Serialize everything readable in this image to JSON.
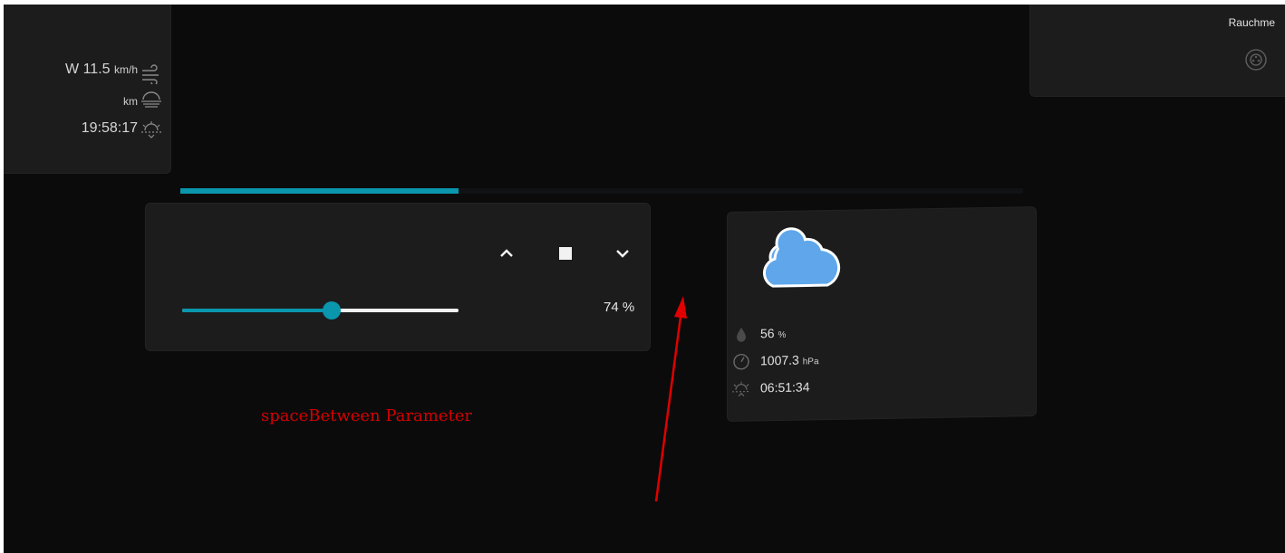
{
  "weather_top": {
    "wind_value": "W 11.5",
    "wind_unit": "km/h",
    "visibility_unit": "km",
    "sunset_time": "19:58:17",
    "icons": [
      "wind-icon",
      "fog-icon",
      "sunset-icon"
    ]
  },
  "smoke_detector": {
    "label": "Rauchme",
    "icon": "smoke-detector-icon"
  },
  "shutter": {
    "progress": 0.33,
    "position_percent": 74,
    "percent_text": "74 %",
    "buttons": [
      "chevron-up-icon",
      "stop-icon",
      "chevron-down-icon"
    ]
  },
  "weather_card": {
    "condition_icon": "cloud-icon",
    "humidity_value": "56",
    "humidity_unit": "%",
    "pressure_value": "1007.3",
    "pressure_unit": "hPa",
    "sunrise_time": "06:51:34"
  },
  "annotation": {
    "label": "spaceBetween Parameter"
  },
  "colors": {
    "background": "#0b0b0c",
    "card": "#1c1c1d",
    "accent": "#0a97ad",
    "cloud": "#5fa7ea",
    "annotation": "#d60000"
  }
}
